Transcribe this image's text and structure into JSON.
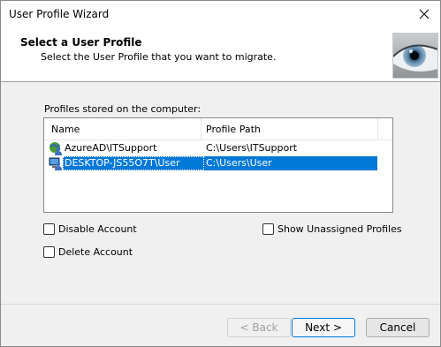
{
  "window": {
    "title": "User Profile Wizard"
  },
  "header": {
    "title": "Select a User Profile",
    "subtitle": "Select the User Profile that you want to migrate."
  },
  "profiles": {
    "label": "Profiles stored on the computer:",
    "columns": [
      "Name",
      "Profile Path"
    ],
    "rows": [
      {
        "name": "AzureAD\\ITSupport",
        "path": "C:\\Users\\ITSupport",
        "selected": false
      },
      {
        "name": "DESKTOP-JS55O7T\\User",
        "path": "C:\\Users\\User",
        "selected": true
      }
    ]
  },
  "options": {
    "disable_account": "Disable Account",
    "delete_account": "Delete Account",
    "show_unassigned": "Show Unassigned Profiles"
  },
  "buttons": {
    "back": "< Back",
    "next": "Next >",
    "cancel": "Cancel"
  },
  "colors": {
    "selection": "#0078d7"
  }
}
